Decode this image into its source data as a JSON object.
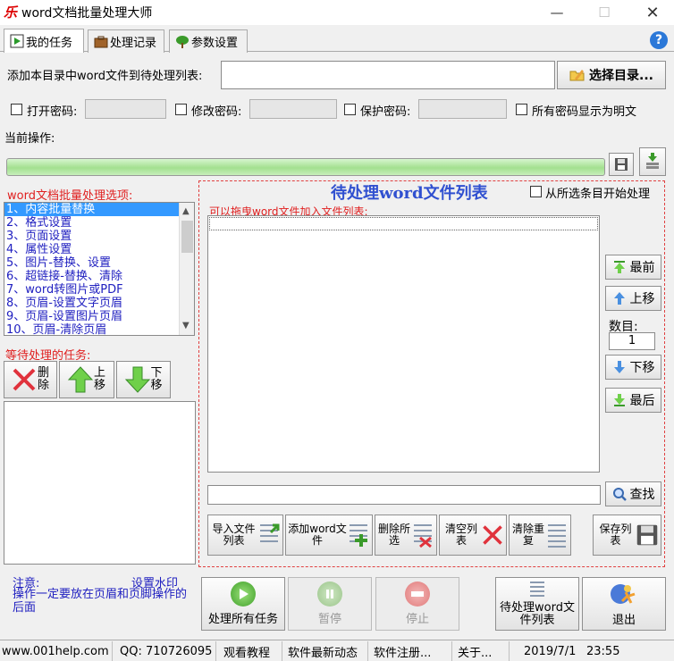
{
  "window": {
    "logo": "乐",
    "title": "word文档批量处理大师"
  },
  "tabs": [
    {
      "label": "我的任务",
      "icon": "play-icon"
    },
    {
      "label": "处理记录",
      "icon": "briefcase-icon"
    },
    {
      "label": "参数设置",
      "icon": "tree-icon"
    }
  ],
  "help": "?",
  "dir_row": {
    "label": "添加本目录中word文件到待处理列表:",
    "value": "",
    "button": "选择目录..."
  },
  "passwords": {
    "open_label": "打开密码:",
    "modify_label": "修改密码:",
    "protect_label": "保护密码:",
    "show_plain_label": "所有密码显示为明文"
  },
  "current_op_label": "当前操作:",
  "options": {
    "title": "word文档批量处理选项:",
    "items": [
      "1、内容批量替换",
      "2、格式设置",
      "3、页面设置",
      "4、属性设置",
      "5、图片-替换、设置",
      "6、超链接-替换、清除",
      "7、word转图片或PDF",
      "8、页眉-设置文字页眉",
      "9、页眉-设置图片页眉",
      "10、页眉-清除页眉"
    ],
    "selected_index": 0
  },
  "pending": {
    "title": "等待处理的任务:",
    "delete": "删除",
    "up": "上移",
    "down": "下移"
  },
  "filelist": {
    "title": "待处理word文件列表",
    "from_selected": "从所选条目开始处理",
    "hint": "可以拖曳word文件加入文件列表:",
    "top": "最前",
    "up": "上移",
    "count_label": "数目:",
    "count_value": "1",
    "down": "下移",
    "bottom": "最后",
    "search_value": "",
    "search_button": "查找",
    "import": "导入文件列表",
    "add": "添加word文件",
    "delete_sel": "删除所选",
    "clear": "清空列表",
    "dedupe": "清除重复",
    "save": "保存列表"
  },
  "notice": {
    "label": "注意:",
    "link": "设置水印",
    "text": "操作一定要放在页眉和页脚操作的后面"
  },
  "actions": {
    "process_all": "处理所有任务",
    "pause": "暂停",
    "stop": "停止",
    "pending_list": "待处理word文件列表",
    "exit": "退出"
  },
  "status": {
    "website": "www.001help.com",
    "qq": "QQ: 710726095",
    "tutorial": "观看教程",
    "news": "软件最新动态",
    "register": "软件注册...",
    "about": "关于...",
    "date": "2019/7/1",
    "time": "23:55"
  },
  "colors": {
    "accent_red": "#e02020",
    "option_blue": "#2020c0",
    "title_blue": "#3050d0",
    "progress_green": "#a3e08f"
  }
}
